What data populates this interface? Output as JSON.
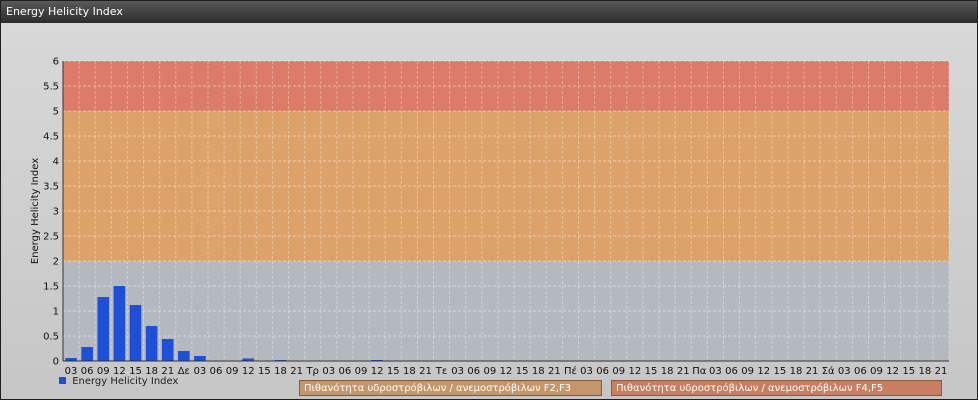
{
  "window": {
    "title": "Energy Helicity Index"
  },
  "legend": {
    "series_label": "Energy Helicity Index",
    "band_f2f3": "Πιθανότητα υδροστρόβιλων / ανεμοστρόβιλων F2,F3",
    "band_f4f5": "Πιθανότητα υδροστρόβιλων / ανεμοστρόβιλων F4,F5"
  },
  "chart_data": {
    "type": "bar",
    "ylabel": "Energy Helicity Index",
    "ylim": [
      0,
      6
    ],
    "yticks": [
      "0",
      "0.5",
      "1",
      "1.5",
      "2",
      "2.5",
      "3",
      "3.5",
      "4",
      "4.5",
      "5",
      "5.5",
      "6"
    ],
    "grid": true,
    "legend_position": "bottom-left",
    "bar_color": "#1f4fd6",
    "bands": [
      {
        "from": 2,
        "to": 5,
        "color": "#e0a060"
      },
      {
        "from": 5,
        "to": 6,
        "color": "#e0745e"
      }
    ],
    "categories": [
      "03",
      "06",
      "09",
      "12",
      "15",
      "18",
      "21",
      "Δε",
      "03",
      "06",
      "09",
      "12",
      "15",
      "18",
      "21",
      "Τρ",
      "03",
      "06",
      "09",
      "12",
      "15",
      "18",
      "21",
      "Τε",
      "03",
      "06",
      "09",
      "12",
      "15",
      "18",
      "21",
      "Πέ",
      "03",
      "06",
      "09",
      "12",
      "15",
      "18",
      "21",
      "Πα",
      "03",
      "06",
      "09",
      "12",
      "15",
      "18",
      "21",
      "Σά",
      "03",
      "06",
      "09",
      "12",
      "15",
      "18",
      "21"
    ],
    "series": [
      {
        "name": "Energy Helicity Index",
        "values": [
          0.06,
          0.28,
          1.28,
          1.5,
          1.12,
          0.7,
          0.44,
          0.2,
          0.1,
          0.01,
          0.01,
          0.05,
          0.01,
          0.02,
          0.01,
          0.01,
          0.01,
          0.01,
          0.01,
          0.02,
          0.01,
          0.01,
          0.01,
          0.01,
          0.01,
          0.01,
          0.01,
          0.01,
          0.01,
          0.01,
          0.01,
          0.01,
          0.01,
          0.01,
          0.01,
          0.01,
          0.01,
          0.01,
          0.01,
          0.01,
          0.01,
          0.01,
          0.01,
          0.01,
          0.01,
          0.01,
          0.01,
          0.01,
          0.01,
          0.01,
          0.01,
          0.01,
          0.01,
          0.01,
          0.01
        ]
      }
    ]
  }
}
